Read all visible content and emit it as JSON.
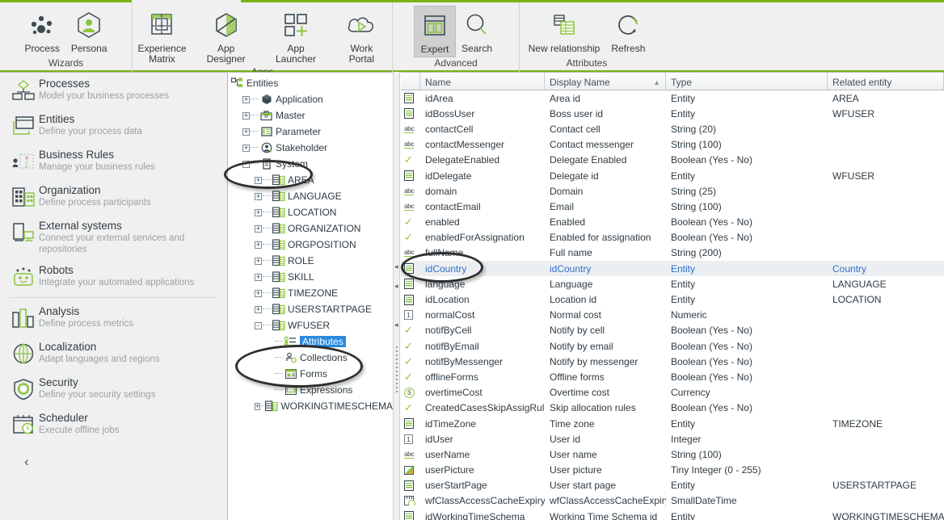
{
  "ribbon": {
    "groups": [
      {
        "label": "Wizards",
        "buttons": [
          {
            "label": "Process",
            "icon": "process-icon",
            "selected": false
          },
          {
            "label": "Persona",
            "icon": "persona-icon",
            "selected": false
          }
        ]
      },
      {
        "label": "Apps",
        "buttons": [
          {
            "label": "Experience\nMatrix",
            "icon": "experience-matrix-icon",
            "selected": false
          },
          {
            "label": "App Designer",
            "icon": "app-designer-icon",
            "selected": false
          },
          {
            "label": "App Launcher",
            "icon": "app-launcher-icon",
            "selected": false
          },
          {
            "label": "Work Portal",
            "icon": "work-portal-icon",
            "selected": false
          }
        ]
      },
      {
        "label": "Advanced",
        "buttons": [
          {
            "label": "Expert",
            "icon": "expert-icon",
            "selected": true
          },
          {
            "label": "Search",
            "icon": "search-icon",
            "selected": false
          }
        ]
      },
      {
        "label": "Attributes",
        "buttons": [
          {
            "label": "New relationship",
            "icon": "new-relationship-icon",
            "selected": false
          },
          {
            "label": "Refresh",
            "icon": "refresh-icon",
            "selected": false
          }
        ]
      }
    ]
  },
  "sidebar": {
    "items": [
      {
        "title": "Processes",
        "subtitle": "Model your business processes",
        "icon": "processes-icon"
      },
      {
        "title": "Entities",
        "subtitle": "Define your process data",
        "icon": "entities-icon"
      },
      {
        "title": "Business Rules",
        "subtitle": "Manage your business rules",
        "icon": "business-rules-icon"
      },
      {
        "title": "Organization",
        "subtitle": "Define process participants",
        "icon": "organization-icon"
      },
      {
        "title": "External systems",
        "subtitle": "Connect your external services and repositories",
        "icon": "external-systems-icon"
      },
      {
        "title": "Robots",
        "subtitle": "Integrate your automated applications",
        "icon": "robots-icon"
      },
      {
        "title": "Analysis",
        "subtitle": "Define process metrics",
        "icon": "analysis-icon"
      },
      {
        "title": "Localization",
        "subtitle": "Adapt languages and regions",
        "icon": "localization-icon"
      },
      {
        "title": "Security",
        "subtitle": "Define your security settings",
        "icon": "security-icon"
      },
      {
        "title": "Scheduler",
        "subtitle": "Execute offline jobs",
        "icon": "scheduler-icon"
      }
    ],
    "collapse_label": "‹"
  },
  "tree": {
    "root": {
      "label": "Entities",
      "icon": "entities-tree-icon"
    },
    "nodes": [
      {
        "label": "Application",
        "depth": 1,
        "toggle": "+",
        "icon": "application-icon",
        "selected": false
      },
      {
        "label": "Master",
        "depth": 1,
        "toggle": "+",
        "icon": "master-icon",
        "selected": false
      },
      {
        "label": "Parameter",
        "depth": 1,
        "toggle": "+",
        "icon": "parameter-icon",
        "selected": false
      },
      {
        "label": "Stakeholder",
        "depth": 1,
        "toggle": "+",
        "icon": "stakeholder-icon",
        "selected": false
      },
      {
        "label": "System",
        "depth": 1,
        "toggle": "-",
        "icon": "system-icon",
        "selected": false
      },
      {
        "label": "AREA",
        "depth": 2,
        "toggle": "+",
        "icon": "table-icon",
        "selected": false
      },
      {
        "label": "LANGUAGE",
        "depth": 2,
        "toggle": "+",
        "icon": "table-icon",
        "selected": false
      },
      {
        "label": "LOCATION",
        "depth": 2,
        "toggle": "+",
        "icon": "table-icon",
        "selected": false
      },
      {
        "label": "ORGANIZATION",
        "depth": 2,
        "toggle": "+",
        "icon": "table-icon",
        "selected": false
      },
      {
        "label": "ORGPOSITION",
        "depth": 2,
        "toggle": "+",
        "icon": "table-icon",
        "selected": false
      },
      {
        "label": "ROLE",
        "depth": 2,
        "toggle": "+",
        "icon": "table-icon",
        "selected": false
      },
      {
        "label": "SKILL",
        "depth": 2,
        "toggle": "+",
        "icon": "table-icon",
        "selected": false
      },
      {
        "label": "TIMEZONE",
        "depth": 2,
        "toggle": "+",
        "icon": "table-icon",
        "selected": false
      },
      {
        "label": "USERSTARTPAGE",
        "depth": 2,
        "toggle": "+",
        "icon": "table-icon",
        "selected": false
      },
      {
        "label": "WFUSER",
        "depth": 2,
        "toggle": "-",
        "icon": "table-icon",
        "selected": false
      },
      {
        "label": "Attributes",
        "depth": 3,
        "toggle": "",
        "icon": "attributes-icon",
        "selected": true
      },
      {
        "label": "Collections",
        "depth": 3,
        "toggle": "",
        "icon": "collections-icon",
        "selected": false
      },
      {
        "label": "Forms",
        "depth": 3,
        "toggle": "",
        "icon": "forms-icon",
        "selected": false
      },
      {
        "label": "Expressions",
        "depth": 3,
        "toggle": "",
        "icon": "expressions-icon",
        "selected": false
      },
      {
        "label": "WORKINGTIMESCHEMA",
        "depth": 2,
        "toggle": "+",
        "icon": "table-icon",
        "selected": false
      }
    ]
  },
  "grid": {
    "columns": [
      {
        "label": "Name",
        "sorted": false
      },
      {
        "label": "Display Name",
        "sorted": true
      },
      {
        "label": "Type",
        "sorted": false
      },
      {
        "label": "Related entity",
        "sorted": false
      }
    ],
    "sort_glyph": "▲",
    "rows": [
      {
        "icon": "entity",
        "name": "idArea",
        "display": "Area id",
        "type": "Entity",
        "related": "AREA",
        "selected": false
      },
      {
        "icon": "entity",
        "name": "idBossUser",
        "display": "Boss user id",
        "type": "Entity",
        "related": "WFUSER",
        "selected": false
      },
      {
        "icon": "abc",
        "name": "contactCell",
        "display": "Contact cell",
        "type": "String (20)",
        "related": "",
        "selected": false
      },
      {
        "icon": "abc",
        "name": "contactMessenger",
        "display": "Contact messenger",
        "type": "String (100)",
        "related": "",
        "selected": false
      },
      {
        "icon": "check",
        "name": "DelegateEnabled",
        "display": "Delegate Enabled",
        "type": "Boolean (Yes - No)",
        "related": "",
        "selected": false
      },
      {
        "icon": "entity",
        "name": "idDelegate",
        "display": "Delegate id",
        "type": "Entity",
        "related": "WFUSER",
        "selected": false
      },
      {
        "icon": "abc",
        "name": "domain",
        "display": "Domain",
        "type": "String (25)",
        "related": "",
        "selected": false
      },
      {
        "icon": "abc",
        "name": "contactEmail",
        "display": "Email",
        "type": "String (100)",
        "related": "",
        "selected": false
      },
      {
        "icon": "check",
        "name": "enabled",
        "display": "Enabled",
        "type": "Boolean (Yes - No)",
        "related": "",
        "selected": false
      },
      {
        "icon": "check",
        "name": "enabledForAssignation",
        "display": "Enabled for assignation",
        "type": "Boolean (Yes - No)",
        "related": "",
        "selected": false
      },
      {
        "icon": "abc",
        "name": "fullName",
        "display": "Full name",
        "type": "String (200)",
        "related": "",
        "selected": false
      },
      {
        "icon": "entity",
        "name": "idCountry",
        "display": "idCountry",
        "type": "Entity",
        "related": "Country",
        "selected": true
      },
      {
        "icon": "entity",
        "name": "language",
        "display": "Language",
        "type": "Entity",
        "related": "LANGUAGE",
        "selected": false
      },
      {
        "icon": "entity",
        "name": "idLocation",
        "display": "Location id",
        "type": "Entity",
        "related": "LOCATION",
        "selected": false
      },
      {
        "icon": "num",
        "name": "normalCost",
        "display": "Normal cost",
        "type": "Numeric",
        "related": "",
        "selected": false
      },
      {
        "icon": "check",
        "name": "notifByCell",
        "display": "Notify by cell",
        "type": "Boolean (Yes - No)",
        "related": "",
        "selected": false
      },
      {
        "icon": "check",
        "name": "notifByEmail",
        "display": "Notify by email",
        "type": "Boolean (Yes - No)",
        "related": "",
        "selected": false
      },
      {
        "icon": "check",
        "name": "notifByMessenger",
        "display": "Notify by messenger",
        "type": "Boolean (Yes - No)",
        "related": "",
        "selected": false
      },
      {
        "icon": "check",
        "name": "offlineForms",
        "display": "Offline forms",
        "type": "Boolean (Yes - No)",
        "related": "",
        "selected": false
      },
      {
        "icon": "currency",
        "name": "overtimeCost",
        "display": "Overtime cost",
        "type": "Currency",
        "related": "",
        "selected": false
      },
      {
        "icon": "check",
        "name": "CreatedCasesSkipAssigRules",
        "display": "Skip allocation rules",
        "type": "Boolean (Yes - No)",
        "related": "",
        "selected": false
      },
      {
        "icon": "entity",
        "name": "idTimeZone",
        "display": "Time zone",
        "type": "Entity",
        "related": "TIMEZONE",
        "selected": false
      },
      {
        "icon": "num",
        "name": "idUser",
        "display": "User id",
        "type": "Integer",
        "related": "",
        "selected": false
      },
      {
        "icon": "abc",
        "name": "userName",
        "display": "User name",
        "type": "String (100)",
        "related": "",
        "selected": false
      },
      {
        "icon": "image",
        "name": "userPicture",
        "display": "User picture",
        "type": "Tiny Integer (0 - 255)",
        "related": "",
        "selected": false
      },
      {
        "icon": "entity",
        "name": "userStartPage",
        "display": "User start page",
        "type": "Entity",
        "related": "USERSTARTPAGE",
        "selected": false
      },
      {
        "icon": "date",
        "name": "wfClassAccessCacheExpiry",
        "display": "wfClassAccessCacheExpiry",
        "type": "SmallDateTime",
        "related": "",
        "selected": false
      },
      {
        "icon": "entity",
        "name": "idWorkingTimeSchema",
        "display": "Working Time Schema id",
        "type": "Entity",
        "related": "WORKINGTIMESCHEMA",
        "selected": false
      }
    ]
  },
  "annotations": {
    "ellipse_system": "System",
    "ellipse_attributes": "Attributes",
    "ellipse_idcountry": "idCountry"
  },
  "colors": {
    "accent_green": "#7ab317",
    "icon_green": "#8cc63f",
    "icon_dark": "#33424c",
    "selection_blue": "#2a8ae0",
    "row_select_bg": "#eceff1",
    "row_select_text": "#2e6fd0"
  }
}
